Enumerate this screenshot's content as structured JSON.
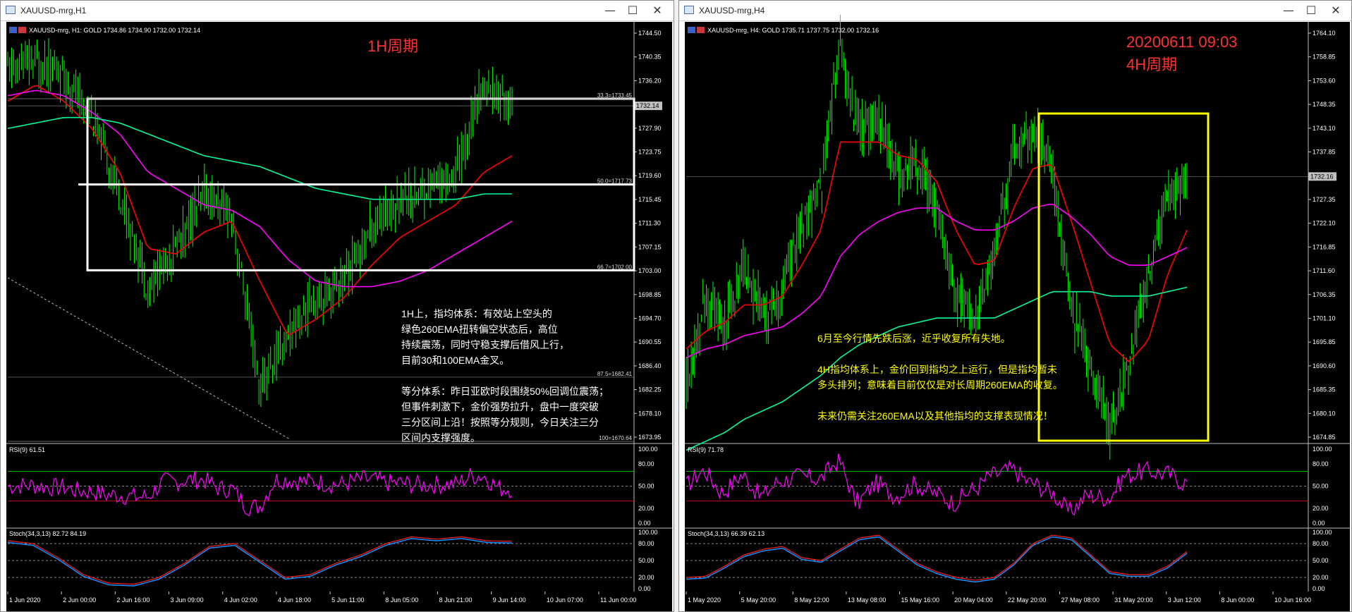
{
  "windows": [
    {
      "title": "XAUUSD-mrg,H1",
      "buttons": {
        "min": "—",
        "max": "☐",
        "close": "✕"
      },
      "header": "XAUUSD-mrg, H1:  GOLD  1734.86  1734.90  1732.00  1732.14",
      "label": "1H周期",
      "price_ticks": [
        "1744.50",
        "1740.35",
        "1736.20",
        "1731.90",
        "1727.90",
        "1723.75",
        "1719.60",
        "1715.45",
        "1711.30",
        "1707.15",
        "1703.00",
        "1698.85",
        "1694.70",
        "1690.55",
        "1686.40",
        "1682.25",
        "1678.10",
        "1673.95"
      ],
      "current_price": "1732.14",
      "fib_labels": [
        "33.3=1733.45",
        "50.0=1717.73",
        "66.7=1702.00",
        "87.5=1682.41",
        "100=1670.64"
      ],
      "rsi_label": "RSI(9) 61.51",
      "stoch_label": "Stoch(34,3,13) 82.72 84.19",
      "osc_ticks": [
        "100.00",
        "80.00",
        "50.00",
        "20.00",
        "0.00"
      ],
      "time_ticks": [
        "1 Jun 2020",
        "2 Jun 00:00",
        "2 Jun 16:00",
        "3 Jun 09:00",
        "4 Jun 02:00",
        "4 Jun 18:00",
        "5 Jun 11:00",
        "8 Jun 05:00",
        "8 Jun 21:00",
        "9 Jun 14:00",
        "10 Jun 07:00",
        "11 Jun 00:00"
      ],
      "notes": [
        "1H上，指均体系：有效站上空头的",
        "绿色260EMA扭转偏空状态后，高位",
        "持续震荡，同时守稳支撑后借风上行，",
        "目前30和100EMA金叉。",
        "",
        "等分体系：昨日亚欧时段围绕50%回调位震荡；",
        "但事件刺激下，金价强势拉升，盘中一度突破",
        "三分区间上沿！按照等分规则，今日关注三分",
        "区间内支撑强度。"
      ]
    },
    {
      "title": "XAUUSD-mrg,H4",
      "buttons": {
        "min": "—",
        "max": "☐",
        "close": "✕"
      },
      "header": "XAUUSD-mrg, H4:  GOLD  1735.71  1737.75  1732.00  1732.16",
      "label_date": "20200611 09:03",
      "label": "4H周期",
      "price_ticks": [
        "1764.10",
        "1758.85",
        "1753.60",
        "1748.35",
        "1743.10",
        "1737.85",
        "1732.60",
        "1727.35",
        "1722.10",
        "1716.85",
        "1711.60",
        "1706.35",
        "1701.10",
        "1695.85",
        "1690.60",
        "1685.35",
        "1680.10",
        "1674.85"
      ],
      "current_price": "1732.16",
      "rsi_label": "RSI(9) 71.78",
      "stoch_label": "Stoch(34,3,13) 66.39 62.13",
      "osc_ticks": [
        "100.00",
        "80.00",
        "50.00",
        "20.00",
        "0.00"
      ],
      "time_ticks": [
        "1 May 2020",
        "5 May 20:00",
        "8 May 12:00",
        "13 May 08:00",
        "15 May 16:00",
        "20 May 04:00",
        "22 May 20:00",
        "27 May 08:00",
        "31 May 20:00",
        "3 Jun 12:00",
        "8 Jun 00:00",
        "10 Jun 16:00"
      ],
      "notes": [
        "6月至今行情先跌后涨，近乎收复所有失地。",
        "",
        "4H指均体系上，金价回到指均之上运行，但是指均暂未",
        "多头排列；意味着目前仅仅是对长周期260EMA的收复。",
        "",
        "未来仍需关注260EMA以及其他指均的支撑表现情况！"
      ]
    }
  ],
  "chart_data": [
    {
      "type": "line",
      "title": "XAUUSD-mrg,H1",
      "x": [
        "1 Jun 2020",
        "2 Jun 00:00",
        "2 Jun 16:00",
        "3 Jun 09:00",
        "4 Jun 02:00",
        "4 Jun 18:00",
        "5 Jun 11:00",
        "8 Jun 05:00",
        "8 Jun 21:00",
        "9 Jun 14:00",
        "10 Jun 07:00",
        "11 Jun 00:00"
      ],
      "ylim": [
        1670.64,
        1746.5
      ],
      "series": [
        {
          "values": [
            1739,
            1740,
            1738,
            1730,
            1716,
            1699,
            1706,
            1716,
            1712,
            1680,
            1690,
            1697,
            1700,
            1710,
            1715,
            1717,
            1720,
            1736,
            1732
          ]
        },
        {
          "values": [
            1733,
            1736,
            1733,
            1728,
            1720,
            1706,
            1705,
            1709,
            1711,
            1700,
            1690,
            1693,
            1697,
            1703,
            1708,
            1711,
            1714,
            1720,
            1723
          ]
        },
        {
          "values": [
            1734,
            1735,
            1734,
            1731,
            1727,
            1720,
            1717,
            1714,
            1713,
            1710,
            1704,
            1700,
            1699,
            1699,
            1700,
            1702,
            1705,
            1708,
            1711
          ]
        },
        {
          "values": [
            1728,
            1729,
            1730,
            1730,
            1729,
            1727,
            1725,
            1723,
            1722,
            1721,
            1719,
            1717,
            1716,
            1715,
            1715,
            1715,
            1715,
            1716,
            1716
          ]
        }
      ],
      "fib_levels": [
        1733.45,
        1717.73,
        1702.0,
        1682.41,
        1670.64
      ],
      "colors": {
        "price": "#00ff00",
        "ema30": "#ff0000",
        "ema100": "#ff00ff",
        "ema260": "#00fa9a",
        "box": "#ffffff",
        "note": "#ffffff",
        "label": "#ff3030"
      },
      "grid": false
    },
    {
      "type": "line",
      "title": "XAUUSD-mrg,H4",
      "x": [
        "1 May 2020",
        "5 May 20:00",
        "8 May 12:00",
        "13 May 08:00",
        "15 May 16:00",
        "20 May 04:00",
        "22 May 20:00",
        "27 May 08:00",
        "31 May 20:00",
        "3 Jun 12:00",
        "8 Jun 00:00",
        "10 Jun 16:00"
      ],
      "ylim": [
        1672,
        1766
      ],
      "series": [
        {
          "values": [
            1685,
            1705,
            1698,
            1712,
            1700,
            1707,
            1720,
            1730,
            1762,
            1742,
            1745,
            1733,
            1735,
            1726,
            1705,
            1700,
            1715,
            1737,
            1742,
            1735,
            1702,
            1690,
            1675,
            1690,
            1710,
            1727,
            1732
          ]
        },
        {
          "values": [
            1693,
            1697,
            1699,
            1703,
            1703,
            1705,
            1712,
            1720,
            1740,
            1740,
            1740,
            1737,
            1736,
            1731,
            1720,
            1712,
            1713,
            1725,
            1734,
            1735,
            1722,
            1708,
            1694,
            1690,
            1695,
            1710,
            1720
          ]
        },
        {
          "values": [
            1691,
            1693,
            1694,
            1696,
            1697,
            1698,
            1701,
            1705,
            1714,
            1719,
            1722,
            1724,
            1725,
            1725,
            1722,
            1720,
            1720,
            1722,
            1725,
            1726,
            1723,
            1719,
            1714,
            1712,
            1712,
            1714,
            1716
          ]
        },
        {
          "values": [
            1670,
            1672,
            1674,
            1677,
            1679,
            1681,
            1684,
            1687,
            1691,
            1694,
            1696,
            1698,
            1699,
            1700,
            1700,
            1700,
            1700,
            1702,
            1704,
            1706,
            1706,
            1706,
            1705,
            1705,
            1705,
            1706,
            1707
          ]
        }
      ],
      "colors": {
        "price": "#00ff00",
        "ema30": "#ff0000",
        "ema100": "#ff00ff",
        "ema260": "#00fa9a",
        "box": "#ffff00",
        "note": "#ffff00",
        "label": "#ff3030"
      },
      "grid": false
    }
  ]
}
